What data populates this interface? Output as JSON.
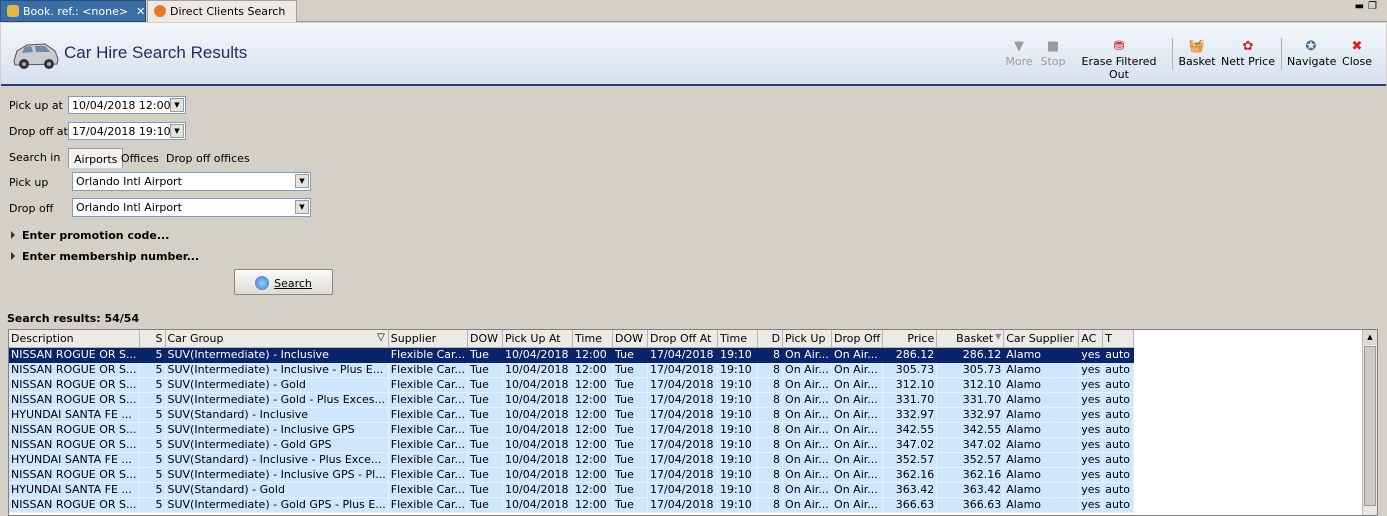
{
  "tabs": [
    {
      "label": "Book. ref.: <none>",
      "active": true
    },
    {
      "label": "Direct Clients Search",
      "active": false
    }
  ],
  "header": {
    "title": "Car Hire Search Results",
    "toolbar": {
      "more": "More",
      "stop": "Stop",
      "erase": "Erase Filtered Out",
      "basket": "Basket",
      "nett_price": "Nett Price",
      "navigate": "Navigate",
      "close": "Close"
    }
  },
  "form": {
    "pickup_at_label": "Pick up at",
    "pickup_at_value": "10/04/2018 12:00",
    "dropoff_at_label": "Drop off at",
    "dropoff_at_value": "17/04/2018 19:10",
    "search_in_label": "Search in",
    "search_in_options": [
      "Airports",
      "Offices",
      "Drop off offices"
    ],
    "search_in_selected": "Airports",
    "pickup_label": "Pick up",
    "pickup_value": "Orlando Intl Airport",
    "dropoff_label": "Drop off",
    "dropoff_value": "Orlando Intl Airport",
    "promotion": "Enter promotion code...",
    "membership": "Enter membership number...",
    "search_button": "Search"
  },
  "results": {
    "label": "Search results: 54/54",
    "columns": [
      "Description",
      "S",
      "Car Group",
      "Supplier",
      "DOW",
      "Pick Up At",
      "Time",
      "DOW",
      "Drop Off At",
      "Time",
      "D",
      "Pick Up",
      "Drop Off",
      "Price",
      "Basket",
      "Car Supplier",
      "AC",
      "T"
    ],
    "rows": [
      [
        "NISSAN ROGUE OR S...",
        "5",
        "SUV(Intermediate) - Inclusive",
        "Flexible Car...",
        "Tue",
        "10/04/2018",
        "12:00",
        "Tue",
        "17/04/2018",
        "19:10",
        "8",
        "On Air...",
        "On Air...",
        "286.12",
        "286.12",
        "Alamo",
        "yes",
        "auto"
      ],
      [
        "NISSAN ROGUE OR S...",
        "5",
        "SUV(Intermediate) - Inclusive - Plus E...",
        "Flexible Car...",
        "Tue",
        "10/04/2018",
        "12:00",
        "Tue",
        "17/04/2018",
        "19:10",
        "8",
        "On Air...",
        "On Air...",
        "305.73",
        "305.73",
        "Alamo",
        "yes",
        "auto"
      ],
      [
        "NISSAN ROGUE OR S...",
        "5",
        "SUV(Intermediate) - Gold",
        "Flexible Car...",
        "Tue",
        "10/04/2018",
        "12:00",
        "Tue",
        "17/04/2018",
        "19:10",
        "8",
        "On Air...",
        "On Air...",
        "312.10",
        "312.10",
        "Alamo",
        "yes",
        "auto"
      ],
      [
        "NISSAN ROGUE OR S...",
        "5",
        "SUV(Intermediate) - Gold - Plus Exces...",
        "Flexible Car...",
        "Tue",
        "10/04/2018",
        "12:00",
        "Tue",
        "17/04/2018",
        "19:10",
        "8",
        "On Air...",
        "On Air...",
        "331.70",
        "331.70",
        "Alamo",
        "yes",
        "auto"
      ],
      [
        "HYUNDAI SANTA FE ...",
        "5",
        "SUV(Standard) - Inclusive",
        "Flexible Car...",
        "Tue",
        "10/04/2018",
        "12:00",
        "Tue",
        "17/04/2018",
        "19:10",
        "8",
        "On Air...",
        "On Air...",
        "332.97",
        "332.97",
        "Alamo",
        "yes",
        "auto"
      ],
      [
        "NISSAN ROGUE OR S...",
        "5",
        "SUV(Intermediate) - Inclusive GPS",
        "Flexible Car...",
        "Tue",
        "10/04/2018",
        "12:00",
        "Tue",
        "17/04/2018",
        "19:10",
        "8",
        "On Air...",
        "On Air...",
        "342.55",
        "342.55",
        "Alamo",
        "yes",
        "auto"
      ],
      [
        "NISSAN ROGUE OR S...",
        "5",
        "SUV(Intermediate) - Gold GPS",
        "Flexible Car...",
        "Tue",
        "10/04/2018",
        "12:00",
        "Tue",
        "17/04/2018",
        "19:10",
        "8",
        "On Air...",
        "On Air...",
        "347.02",
        "347.02",
        "Alamo",
        "yes",
        "auto"
      ],
      [
        "HYUNDAI SANTA FE ...",
        "5",
        "SUV(Standard) - Inclusive - Plus Exce...",
        "Flexible Car...",
        "Tue",
        "10/04/2018",
        "12:00",
        "Tue",
        "17/04/2018",
        "19:10",
        "8",
        "On Air...",
        "On Air...",
        "352.57",
        "352.57",
        "Alamo",
        "yes",
        "auto"
      ],
      [
        "NISSAN ROGUE OR S...",
        "5",
        "SUV(Intermediate) - Inclusive GPS - Pl...",
        "Flexible Car...",
        "Tue",
        "10/04/2018",
        "12:00",
        "Tue",
        "17/04/2018",
        "19:10",
        "8",
        "On Air...",
        "On Air...",
        "362.16",
        "362.16",
        "Alamo",
        "yes",
        "auto"
      ],
      [
        "HYUNDAI SANTA FE ...",
        "5",
        "SUV(Standard) - Gold",
        "Flexible Car...",
        "Tue",
        "10/04/2018",
        "12:00",
        "Tue",
        "17/04/2018",
        "19:10",
        "8",
        "On Air...",
        "On Air...",
        "363.42",
        "363.42",
        "Alamo",
        "yes",
        "auto"
      ],
      [
        "NISSAN ROGUE OR S...",
        "5",
        "SUV(Intermediate) - Gold GPS - Plus E...",
        "Flexible Car...",
        "Tue",
        "10/04/2018",
        "12:00",
        "Tue",
        "17/04/2018",
        "19:10",
        "8",
        "On Air...",
        "On Air...",
        "366.63",
        "366.63",
        "Alamo",
        "yes",
        "auto"
      ]
    ],
    "selected_row": 0
  }
}
